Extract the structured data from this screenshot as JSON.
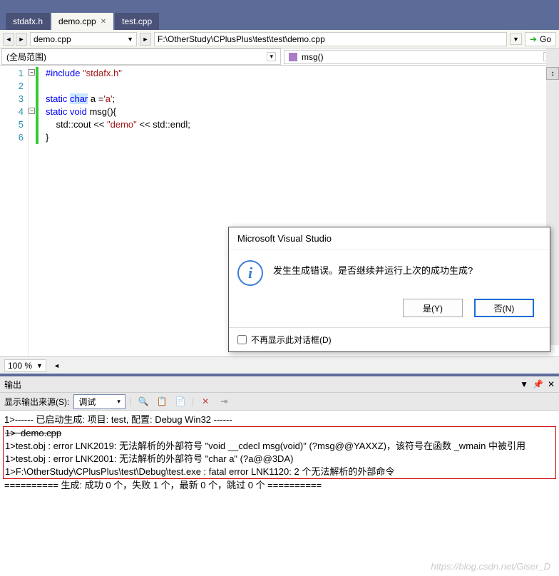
{
  "tabs": [
    {
      "label": "stdafx.h",
      "active": false
    },
    {
      "label": "demo.cpp",
      "active": true
    },
    {
      "label": "test.cpp",
      "active": false
    }
  ],
  "nav": {
    "file_dd": "demo.cpp",
    "path": "F:\\OtherStudy\\CPlusPlus\\test\\test\\demo.cpp",
    "go": "Go"
  },
  "scope": {
    "left": "(全局范围)",
    "right": "msg()"
  },
  "code": {
    "lines": [
      {
        "n": 1,
        "html": "<span class='kw'>#include</span> <span class='str'>\"stdafx.h\"</span>"
      },
      {
        "n": 2,
        "html": ""
      },
      {
        "n": 3,
        "html": "<span class='kw'>static</span> <span class='typ sel'>char</span> a =<span class='str'>'a'</span>;"
      },
      {
        "n": 4,
        "html": "<span class='kw'>static</span> <span class='typ'>void</span> msg(){"
      },
      {
        "n": 5,
        "html": "    std::cout &lt;&lt; <span class='str'>\"demo\"</span> &lt;&lt; std::endl;"
      },
      {
        "n": 6,
        "html": "}"
      }
    ]
  },
  "zoom": {
    "value": "100 %"
  },
  "dialog": {
    "title": "Microsoft Visual Studio",
    "message": "发生生成错误。是否继续并运行上次的成功生成?",
    "yes": "是(Y)",
    "no": "否(N)",
    "checkbox": "不再显示此对话框(D)"
  },
  "outputPanel": {
    "title": "输出",
    "sourceLabel": "显示输出来源(S):",
    "source": "调试",
    "lines": [
      "1>------ 已启动生成: 项目: test, 配置: Debug Win32 ------",
      "1>  demo.cpp",
      "1>test.obj : error LNK2019: 无法解析的外部符号 \"void __cdecl msg(void)\" (?msg@@YAXXZ)，该符号在函数 _wmain 中被引用",
      "1>test.obj : error LNK2001: 无法解析的外部符号 \"char a\" (?a@@3DA)",
      "1>F:\\OtherStudy\\CPlusPlus\\test\\Debug\\test.exe : fatal error LNK1120: 2 个无法解析的外部命令",
      "========== 生成: 成功 0 个，失败 1 个，最新 0 个，跳过 0 个 =========="
    ]
  },
  "watermark": "https://blog.csdn.net/Giser_D"
}
